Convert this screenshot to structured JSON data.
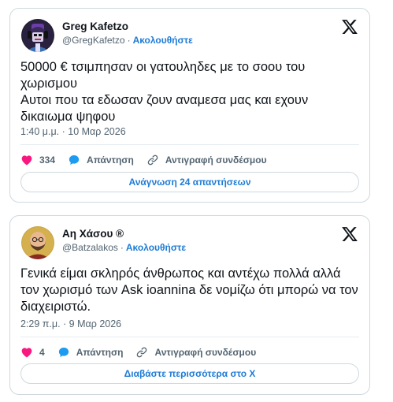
{
  "colors": {
    "accent": "#1d7bd6",
    "like": "#f91880",
    "reply": "#1d9bf0",
    "muted": "#536471"
  },
  "tweets": [
    {
      "author": {
        "name": "Greg Kafetzo",
        "handle": "@GregKafetzo",
        "avatar_icon": "dj-avatar-icon"
      },
      "follow_label": "Ακολουθήστε",
      "text": "50000 € τσιμπησαν οι γατουληδες με το σοου του χωρισμου\nΑυτοι που τα εδωσαν ζουν αναμεσα μας και εχουν δικαιωμα ψηφου",
      "timestamp": "1:40 μ.μ. · 10 Μαρ 2026",
      "likes": "334",
      "reply_label": "Απάντηση",
      "copy_link_label": "Αντιγραφή συνδέσμου",
      "read_more_label": "Ανάγνωση 24 απαντήσεων"
    },
    {
      "author": {
        "name": "Αη Χάσου ®",
        "handle": "@Batzalakos",
        "avatar_icon": "bald-man-avatar-icon"
      },
      "follow_label": "Ακολουθήστε",
      "text": "Γενικά είμαι σκληρός άνθρωπος και αντέχω πολλά αλλά τον χωρισμό των Ask ioannina δε νομίζω ότι μπορώ να τον διαχειριστώ.",
      "timestamp": "2:29 π.μ. · 9 Μαρ 2026",
      "likes": "4",
      "reply_label": "Απάντηση",
      "copy_link_label": "Αντιγραφή συνδέσμου",
      "read_more_label": "Διαβάστε περισσότερα στο X"
    }
  ]
}
